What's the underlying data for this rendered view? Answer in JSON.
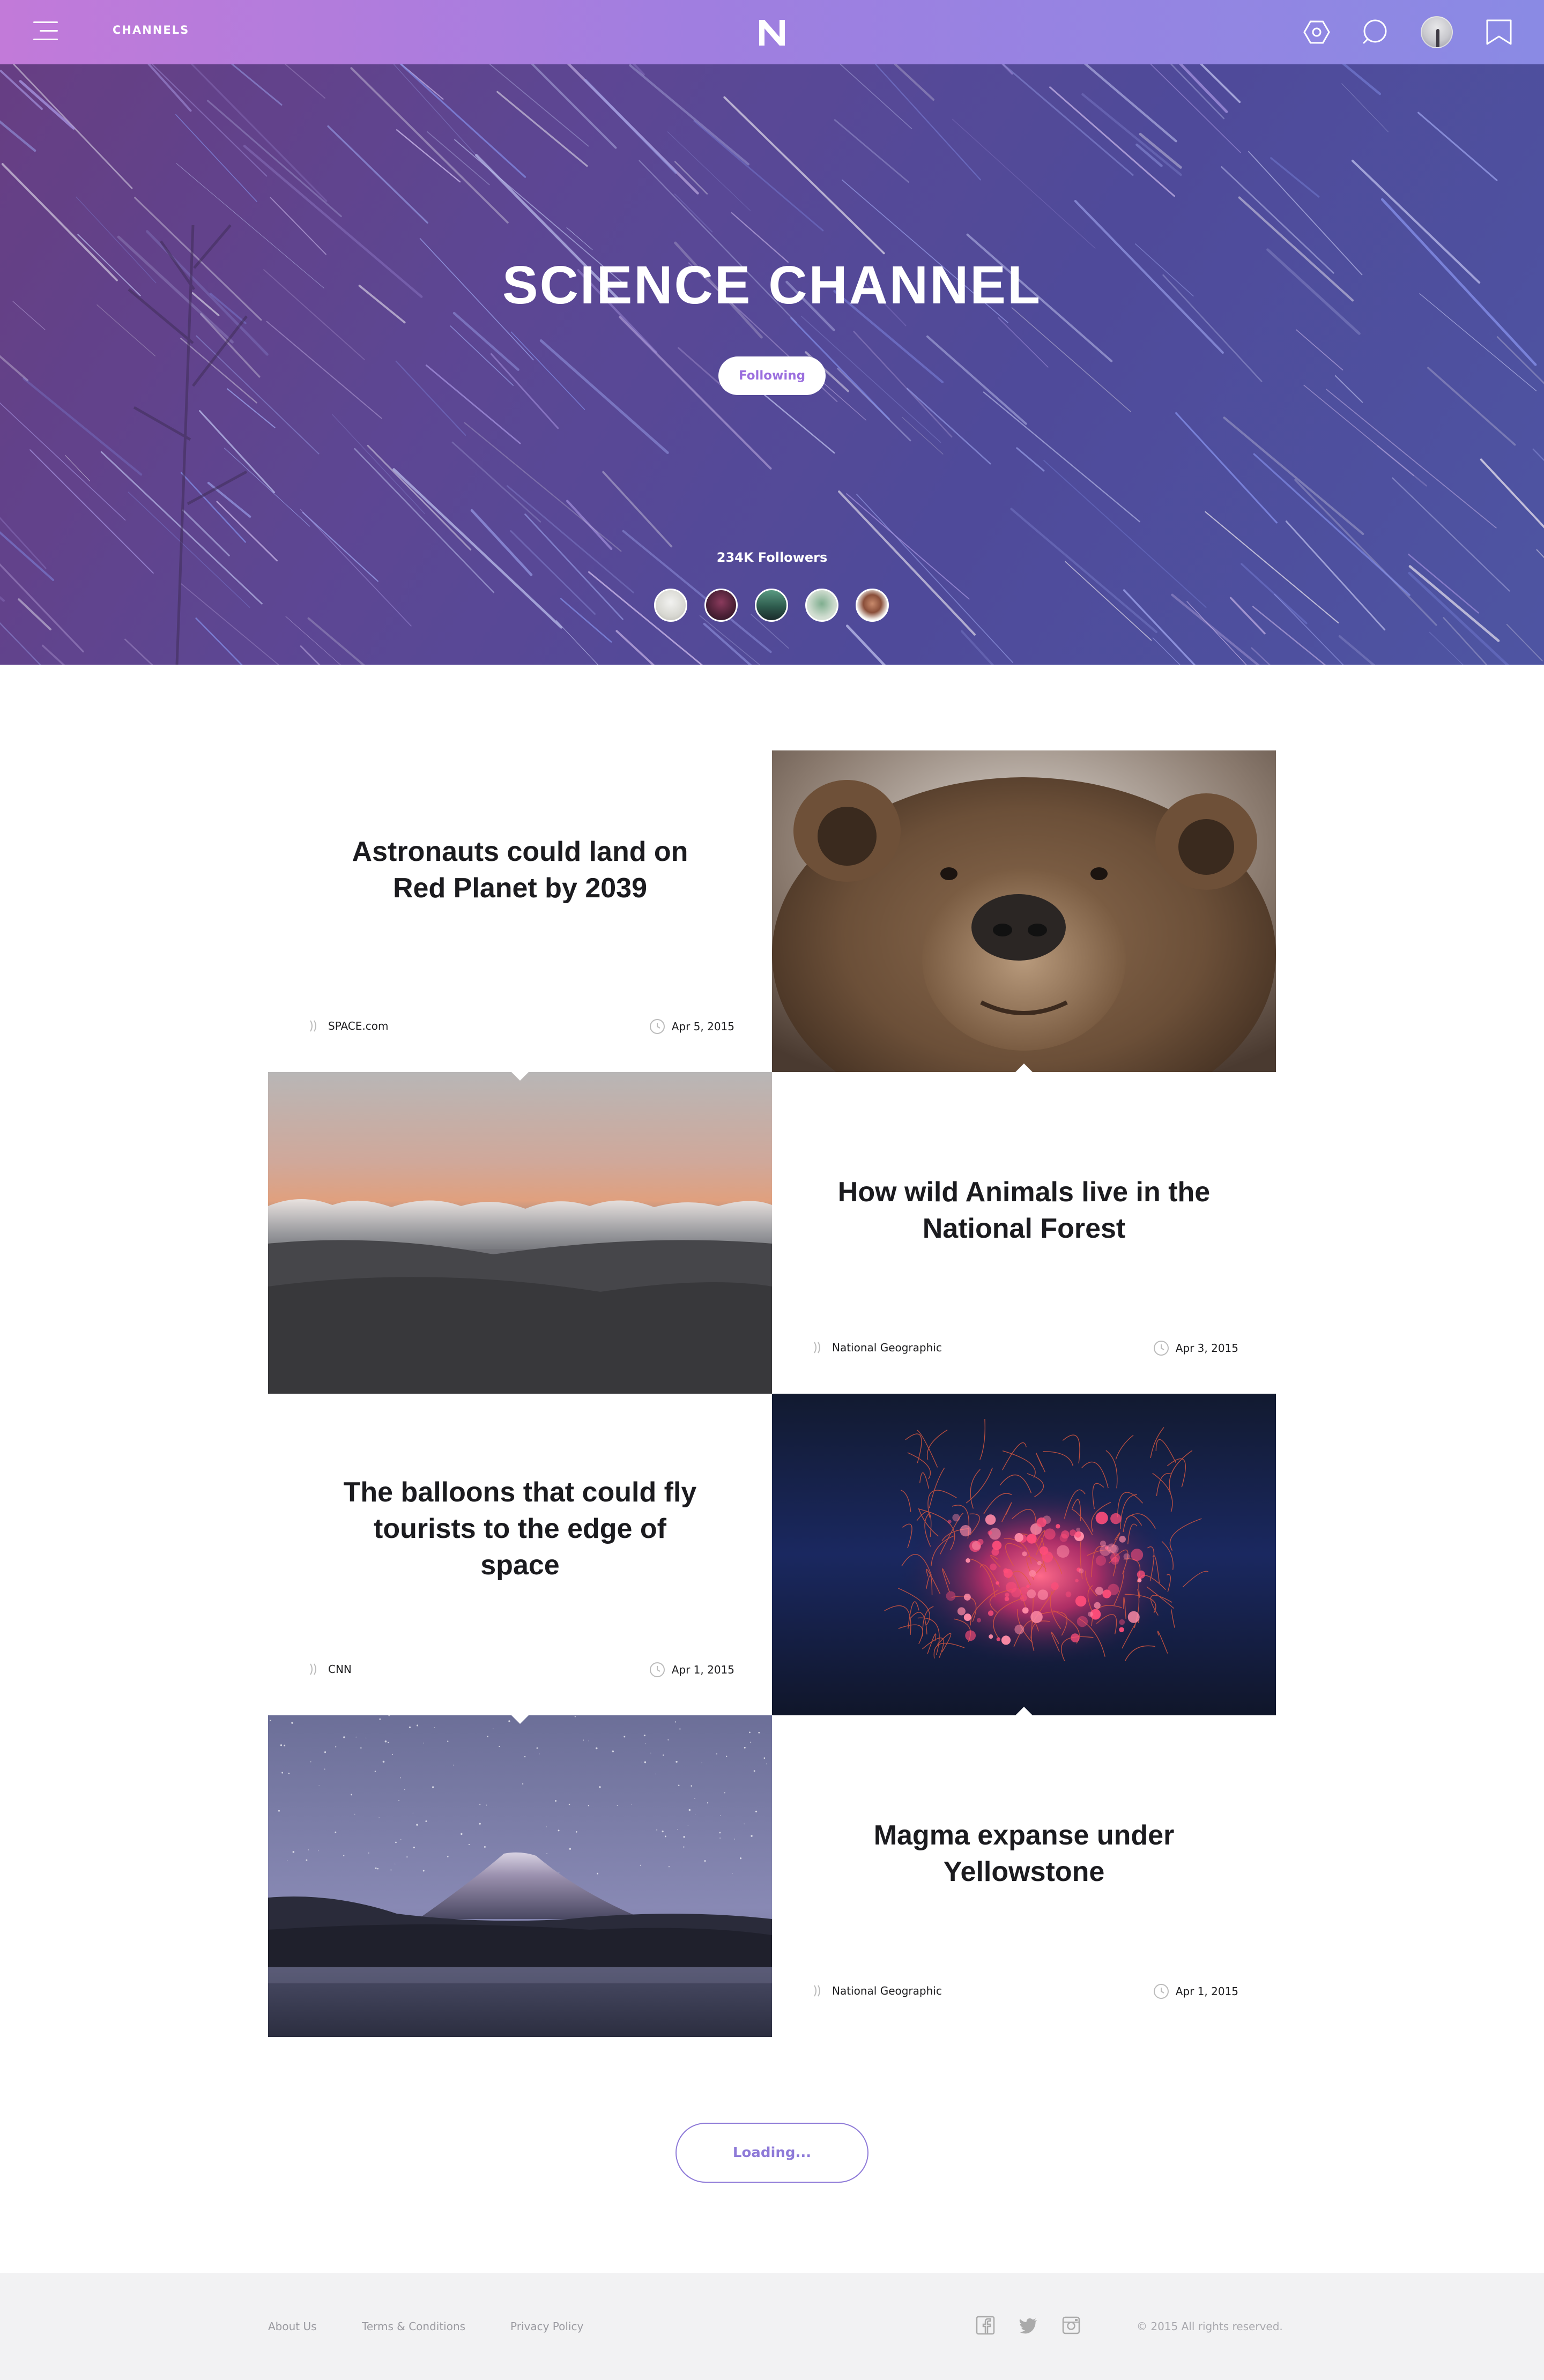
{
  "nav": {
    "channels_label": "CHANNELS",
    "logo_letter": "N"
  },
  "hero": {
    "title": "SCIENCE CHANNEL",
    "follow_label": "Following",
    "followers_text": "234K Followers"
  },
  "articles": [
    {
      "title": "Astronauts could land on Red Planet by 2039",
      "source": "SPACE.com",
      "date": "Apr 5, 2015",
      "image": "bear"
    },
    {
      "title": "How wild Animals live in the National Forest",
      "source": "National Geographic",
      "date": "Apr 3, 2015",
      "image": "clouds"
    },
    {
      "title": "The balloons that could fly tourists to the edge of space",
      "source": "CNN",
      "date": "Apr 1, 2015",
      "image": "embers"
    },
    {
      "title": "Magma expanse under Yellowstone",
      "source": "National Geographic",
      "date": "Apr 1, 2015",
      "image": "mountain"
    }
  ],
  "loading_label": "Loading...",
  "footer": {
    "links": [
      "About Us",
      "Terms & Conditions",
      "Privacy Policy"
    ],
    "copyright": "© 2015 All rights reserved."
  },
  "colors": {
    "accent": "#9b6fde",
    "topbar_start": "#c27ad9",
    "topbar_end": "#8a8ae4",
    "footer_bg": "#f2f2f3"
  },
  "icons": [
    "menu-icon",
    "logo-icon",
    "hexagon-settings-icon",
    "search-icon",
    "avatar",
    "bookmark-icon",
    "source-icon",
    "clock-icon",
    "facebook-icon",
    "twitter-icon",
    "instagram-icon"
  ]
}
